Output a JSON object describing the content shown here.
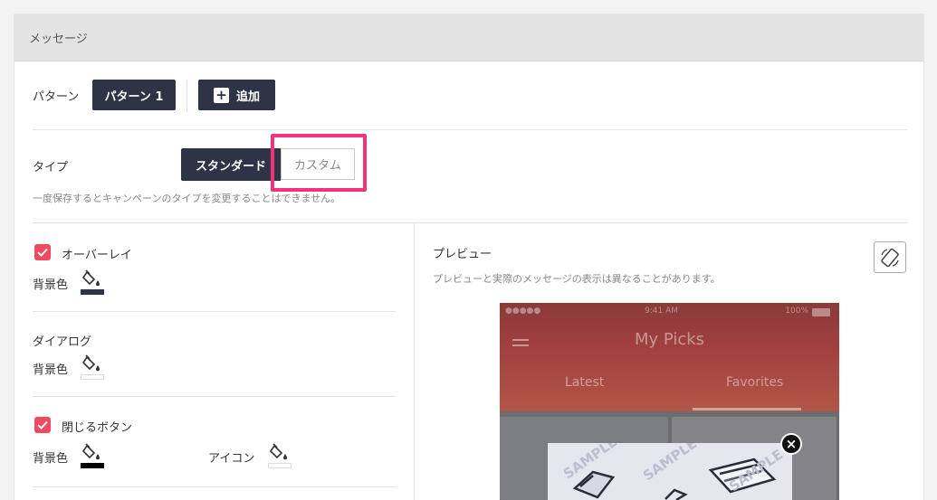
{
  "panel": {
    "title": "メッセージ"
  },
  "pattern": {
    "label": "パターン",
    "selected": "パターン 1",
    "add_label": "追加",
    "add_icon": "plus-square-icon"
  },
  "type": {
    "label": "タイプ",
    "options": [
      "スタンダード",
      "カスタム"
    ],
    "selected": "スタンダード",
    "note": "一度保存するとキャンペーンのタイプを変更することはできません。"
  },
  "settings": {
    "overlay": {
      "label": "オーバーレイ",
      "checked": true,
      "bg_label": "背景色",
      "bg_color": "#2e3446"
    },
    "dialog": {
      "label": "ダイアログ",
      "bg_label": "背景色",
      "bg_color": "#ffffff"
    },
    "close_button": {
      "label": "閉じるボタン",
      "checked": true,
      "bg_label": "背景色",
      "bg_color": "#000000",
      "icon_label": "アイコン",
      "icon_color": "#ffffff"
    }
  },
  "preview": {
    "title": "プレビュー",
    "note": "プレビューと実際のメッセージの表示は異なることがあります。",
    "rotate_icon": "rotate-device-icon",
    "phone": {
      "status_signal": "●●●●●",
      "status_time": "9:41 AM",
      "status_battery": "100%",
      "app_title": "My Picks",
      "tabs": [
        "Latest",
        "Favorites"
      ],
      "active_tab": "Favorites",
      "watermark": "SAMPLE"
    }
  },
  "colors": {
    "accent_dark": "#2e3446",
    "checkbox": "#f04a63",
    "highlight": "#f2327a"
  }
}
